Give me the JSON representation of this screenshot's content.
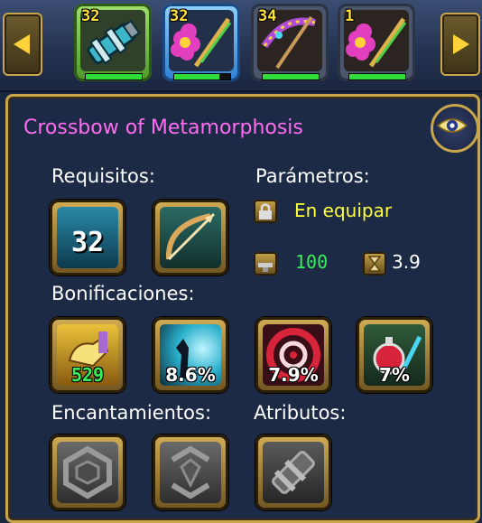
{
  "toolbar": {
    "prev_arrow_icon": "arrow-left-icon",
    "next_arrow_icon": "arrow-right-icon",
    "slots": [
      {
        "level": "32",
        "item": "cannon",
        "frame": "green",
        "bar": 1.0
      },
      {
        "level": "32",
        "item": "flower-staff",
        "frame": "blue",
        "bar": 0.8
      },
      {
        "level": "34",
        "item": "crossbow",
        "frame": "grey",
        "bar": 1.0
      },
      {
        "level": "1",
        "item": "flower-staff",
        "frame": "grey",
        "bar": 1.0
      }
    ]
  },
  "item": {
    "title": "Crossbow of Metamorphosis",
    "title_color": "#ff6cf0",
    "eye_icon": "eye-icon"
  },
  "requirements": {
    "label": "Requisitos:",
    "level": "32",
    "weapon_icon": "bow-icon"
  },
  "parameters": {
    "label": "Parámetros:",
    "bind_text": "En equipar",
    "bind_color": "#ffff3a",
    "damage": "100",
    "damage_color": "#35f05a",
    "speed": "3.9"
  },
  "bonuses": {
    "label": "Bonificaciones:",
    "items": [
      {
        "icon": "hand-icon",
        "value": "529"
      },
      {
        "icon": "dodge-icon",
        "value": "8.6%"
      },
      {
        "icon": "target-icon",
        "value": "7.9%"
      },
      {
        "icon": "potion-icon",
        "value": "7%"
      }
    ]
  },
  "enchantments": {
    "label": "Encantamientos:"
  },
  "attributes": {
    "label": "Atributos:"
  },
  "sockets": [
    "socket-icon",
    "socket-icon",
    "socket-icon"
  ]
}
